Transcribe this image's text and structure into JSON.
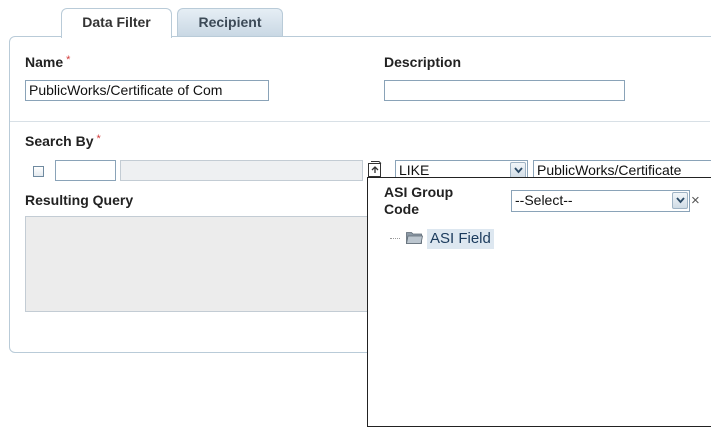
{
  "tabs": [
    {
      "label": "Data Filter",
      "active": true
    },
    {
      "label": "Recipient",
      "active": false
    }
  ],
  "name_field": {
    "label": "Name",
    "required_marker": "*",
    "value": "PublicWorks/Certificate of Com"
  },
  "description_field": {
    "label": "Description",
    "value": ""
  },
  "search_by": {
    "label": "Search By",
    "required_marker": "*",
    "operator": "LIKE",
    "value": "PublicWorks/Certificate"
  },
  "resulting_query": {
    "label": "Resulting Query",
    "value": ""
  },
  "popup": {
    "label_line1": "ASI Group",
    "label_line2": "Code",
    "select_value": "--Select--",
    "close_glyph": "×",
    "tree_items": [
      {
        "label": "ASI Field"
      }
    ]
  },
  "colors": {
    "accent": "#b9cbd8",
    "required": "#d23b3b",
    "tree_highlight": "#dde7f0"
  }
}
